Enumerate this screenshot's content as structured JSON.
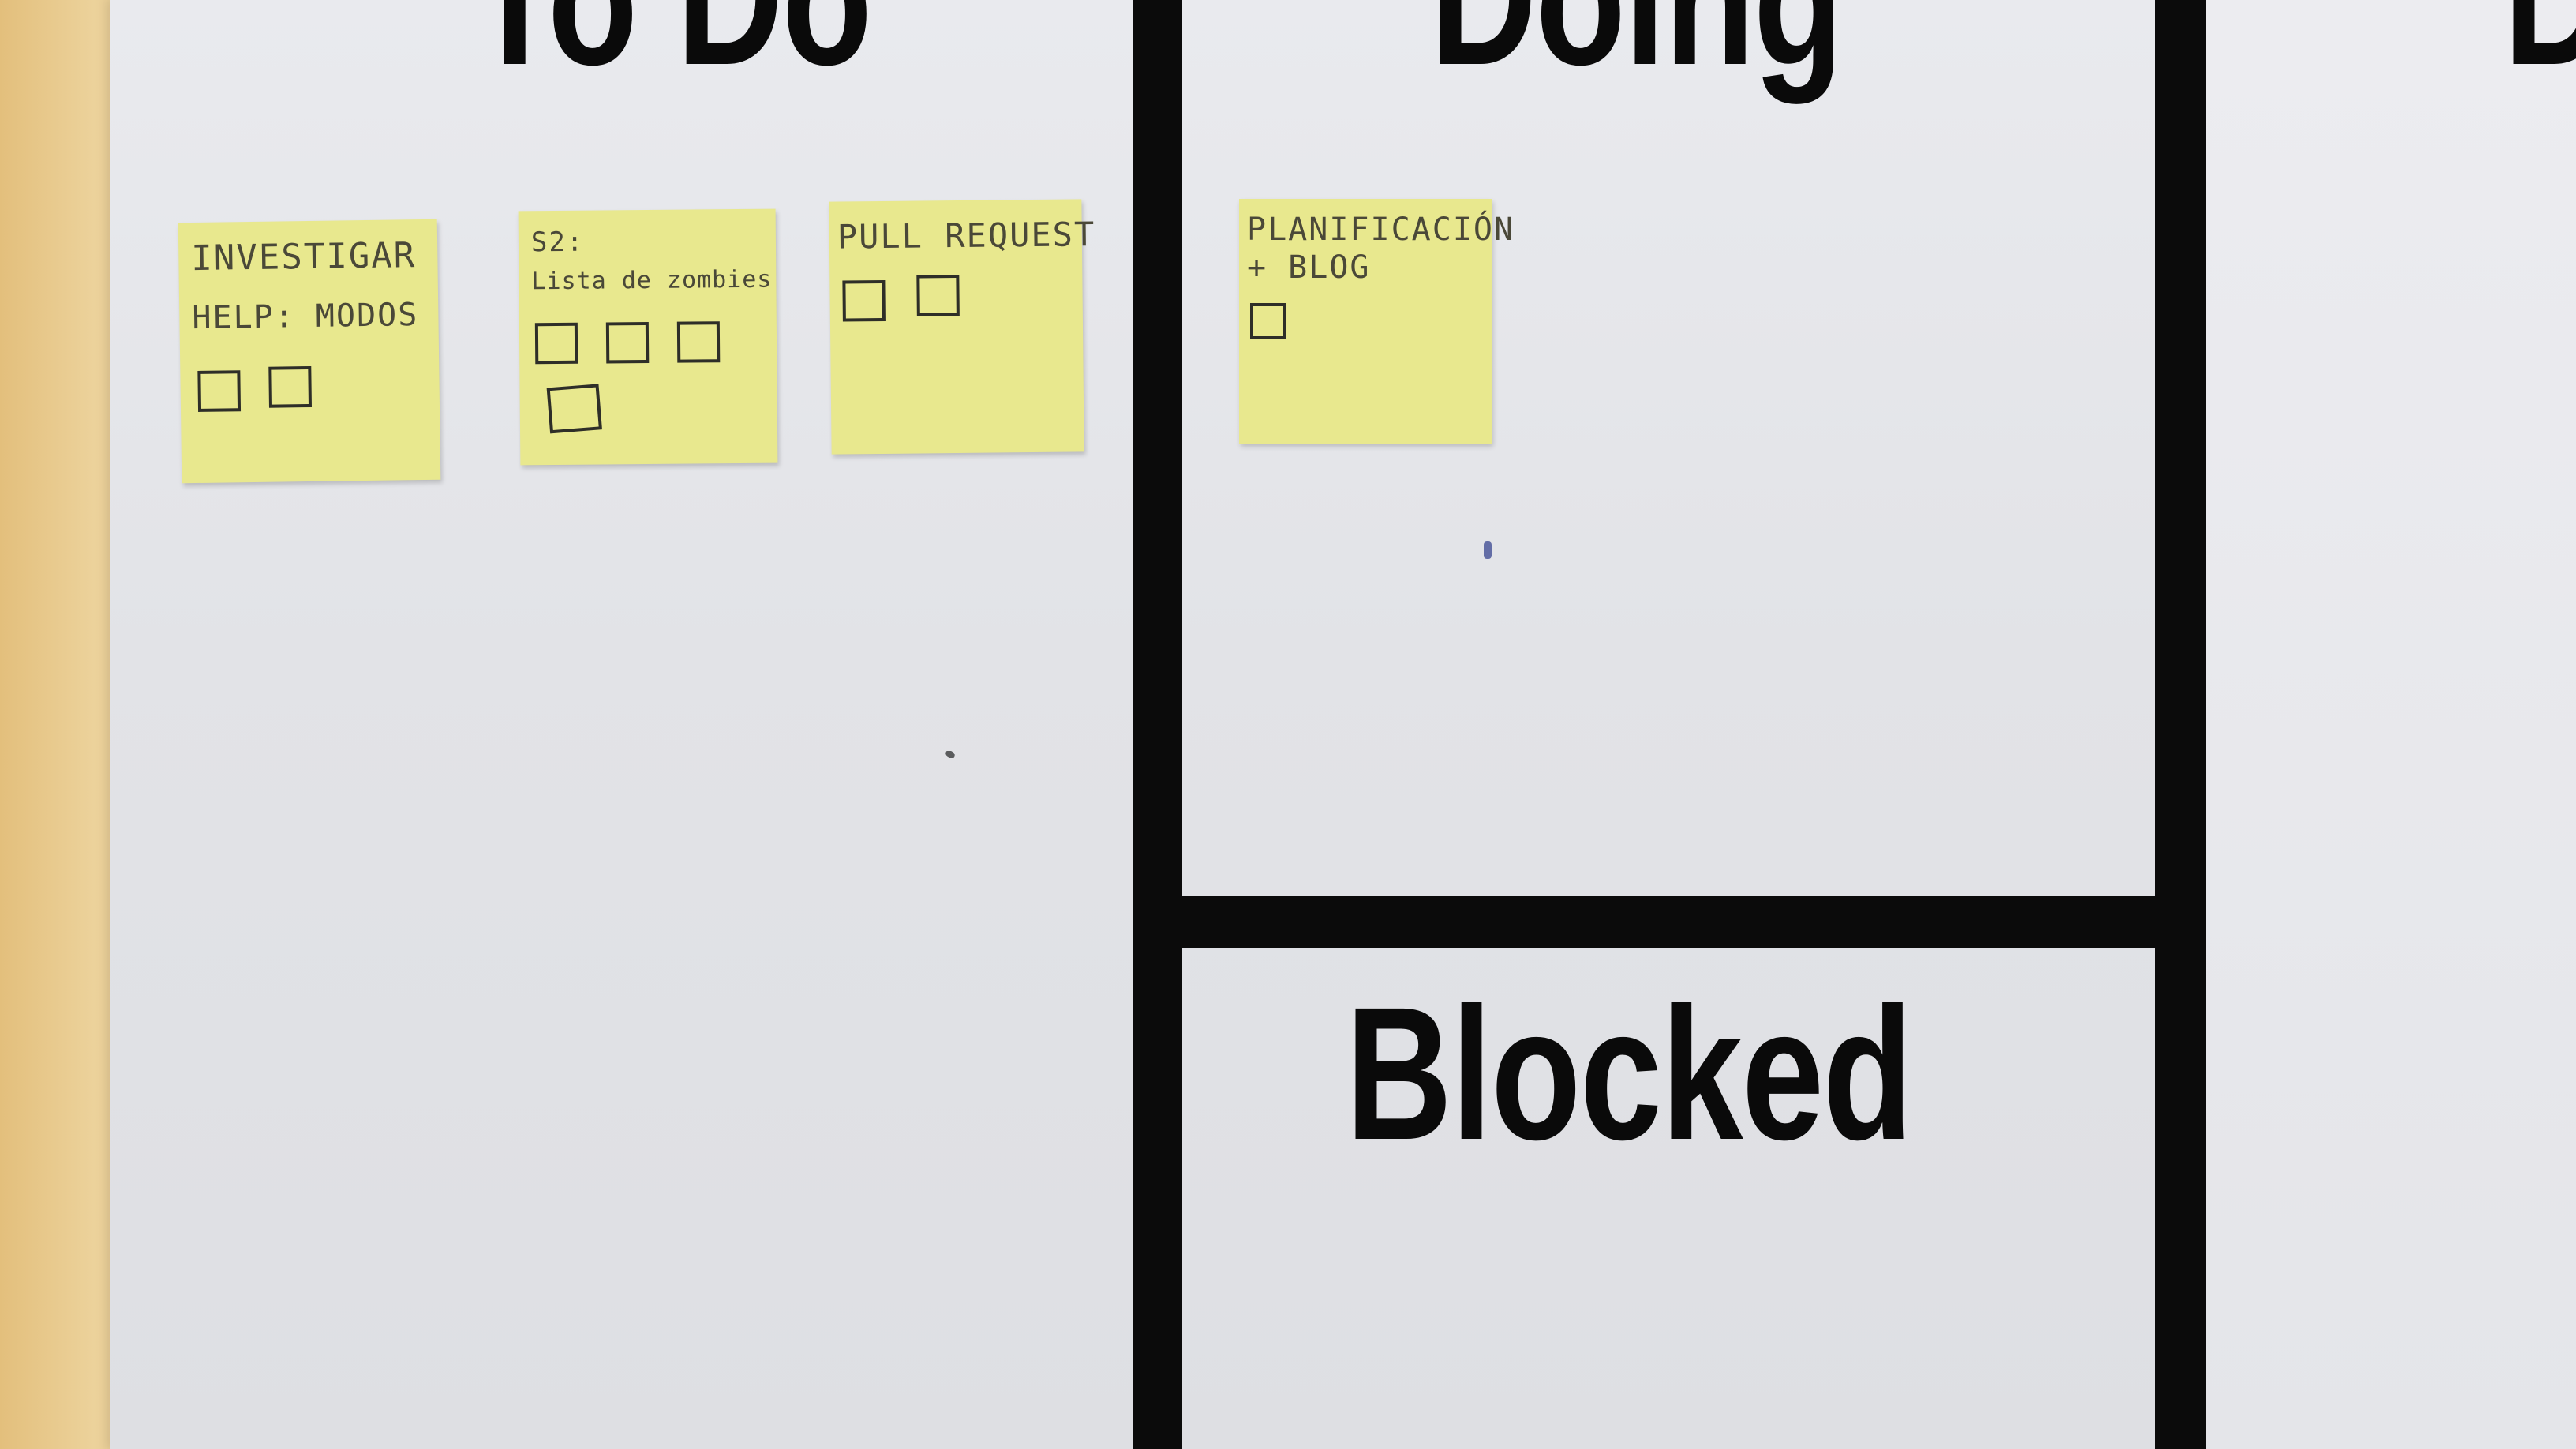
{
  "board": {
    "columns": {
      "todo": "To Do",
      "doing": "Doing",
      "done_partial": "D",
      "blocked": "Blocked"
    },
    "notes": [
      {
        "lines": [
          "INVESTIGAR",
          "HELP: MODOS"
        ],
        "checkboxes": 2
      },
      {
        "lines": [
          "S2:",
          "Lista de zombies"
        ],
        "checkboxes": 4
      },
      {
        "lines": [
          "PULL REQUEST"
        ],
        "checkboxes": 2
      },
      {
        "lines": [
          "PLANIFICACIÓN",
          "+ BLOG"
        ],
        "checkboxes": 1
      }
    ]
  },
  "colors": {
    "wall": "#e6c98a",
    "paper": "#e4e5e9",
    "tape": "#0b0b0b",
    "sticky_note": "#e8e88e"
  }
}
